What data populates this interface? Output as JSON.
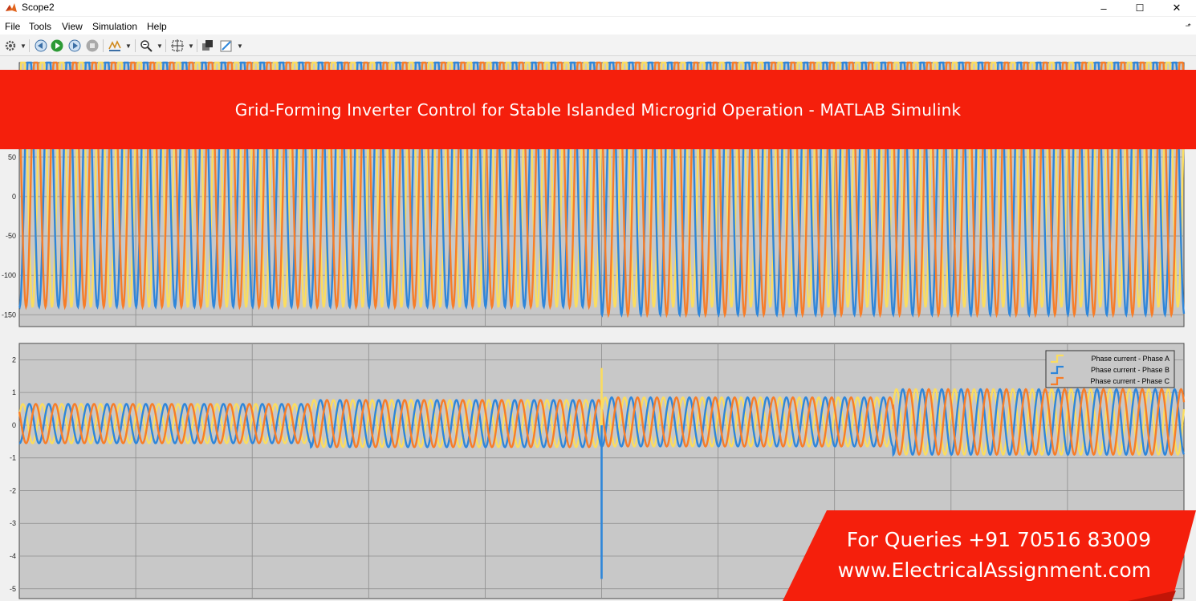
{
  "window": {
    "title": "Scope2",
    "minimize_glyph": "–",
    "maximize_glyph": "☐",
    "close_glyph": "✕"
  },
  "menu": {
    "items": [
      "File",
      "Tools",
      "View",
      "Simulation",
      "Help"
    ]
  },
  "toolbar": {
    "icons": [
      "settings-icon",
      "step-back-icon",
      "run-icon",
      "step-forward-icon",
      "stop-icon",
      "signal-select-icon",
      "zoom-icon",
      "fit-axes-icon",
      "bring-front-icon",
      "style-icon"
    ]
  },
  "banner": {
    "text": "Grid-Forming Inverter Control for Stable Islanded Microgrid Operation - MATLAB Simulink"
  },
  "promo": {
    "line1": "For Queries +91 70516 83009",
    "line2": "www.ElectricalAssignment.com"
  },
  "colors": {
    "phase_a": "#fbdd5f",
    "phase_b": "#2e86da",
    "phase_c": "#f77d28",
    "axes_bg": "#c8c8c8",
    "banner": "#f51f0c"
  },
  "chart_data": [
    {
      "type": "line",
      "title": "",
      "xlabel": "",
      "ylabel": "",
      "ylim": [
        -165,
        170
      ],
      "yticks": [
        50,
        0,
        -50,
        -100,
        -150
      ],
      "grid": true,
      "cycles": 60,
      "disturbance_at_fraction": 0.5,
      "series": [
        {
          "amplitude_before": 170,
          "offset_before": 30,
          "amplitude_after": 170,
          "offset_after": 30
        },
        {
          "amplitude_before": 170,
          "offset_before": 30,
          "amplitude_after": 175,
          "offset_after": 25
        },
        {
          "amplitude_before": 170,
          "offset_before": 30,
          "amplitude_after": 175,
          "offset_after": 25
        }
      ]
    },
    {
      "type": "line",
      "title": "",
      "xlabel": "",
      "ylabel": "",
      "ylim": [
        -5.3,
        2.5
      ],
      "yticks": [
        2,
        1,
        0,
        -1,
        -2,
        -3,
        -4,
        -5
      ],
      "grid": true,
      "cycles": 60,
      "legend": {
        "placement": "top-right",
        "entries": [
          "Phase current - Phase A",
          "Phase current - Phase B",
          "Phase current - Phase C"
        ]
      },
      "segments": [
        {
          "from": 0.0,
          "to": 0.25,
          "amplitude": 0.6,
          "offset": 0.05
        },
        {
          "from": 0.25,
          "to": 0.5,
          "amplitude": 0.72,
          "offset": 0.05
        },
        {
          "from": 0.5,
          "to": 0.75,
          "amplitude": 0.75,
          "offset": 0.1
        },
        {
          "from": 0.75,
          "to": 1.0,
          "amplitude": 1.0,
          "offset": 0.1
        }
      ],
      "transients": [
        {
          "at_fraction": 0.5,
          "series": "Phase current - Phase B",
          "min": -4.7
        },
        {
          "at_fraction": 0.5,
          "series": "Phase current - Phase A",
          "max": 1.75
        }
      ]
    }
  ]
}
